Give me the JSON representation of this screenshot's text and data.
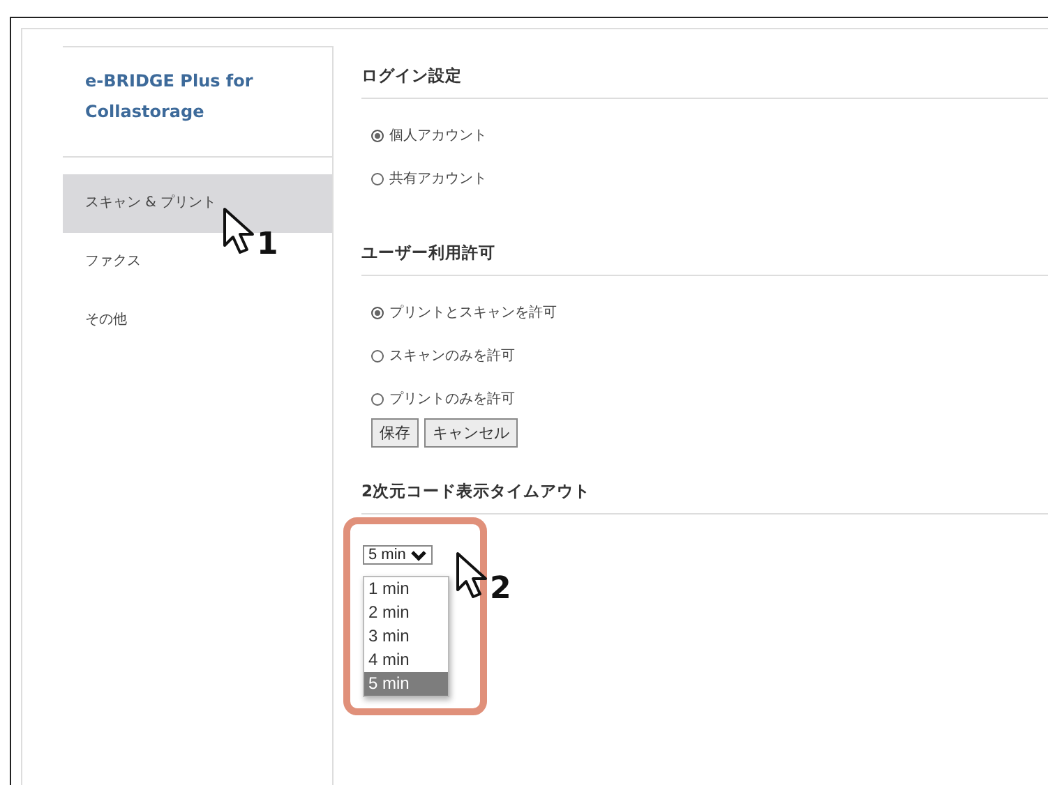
{
  "sidebar": {
    "title": "e-BRIDGE Plus for Collastorage",
    "items": [
      {
        "label": "スキャン & プリント",
        "selected": true
      },
      {
        "label": "ファクス",
        "selected": false
      },
      {
        "label": "その他",
        "selected": false
      }
    ]
  },
  "sections": [
    {
      "title": "ログイン設定",
      "radios": [
        {
          "label": "個人アカウント",
          "selected": true
        },
        {
          "label": "共有アカウント",
          "selected": false
        }
      ]
    },
    {
      "title": "ユーザー利用許可",
      "radios": [
        {
          "label": "プリントとスキャンを許可",
          "selected": true
        },
        {
          "label": "スキャンのみを許可",
          "selected": false
        },
        {
          "label": "プリントのみを許可",
          "selected": false
        }
      ],
      "buttons": [
        "保存",
        "キャンセル"
      ]
    },
    {
      "title": "2次元コード表示タイムアウト",
      "dropdown": {
        "value": "5 min",
        "options": [
          {
            "label": "1 min",
            "selected": false
          },
          {
            "label": "2 min",
            "selected": false
          },
          {
            "label": "3 min",
            "selected": false
          },
          {
            "label": "4 min",
            "selected": false
          },
          {
            "label": "5 min",
            "selected": true
          }
        ]
      }
    }
  ],
  "callouts": [
    "1",
    "2"
  ]
}
